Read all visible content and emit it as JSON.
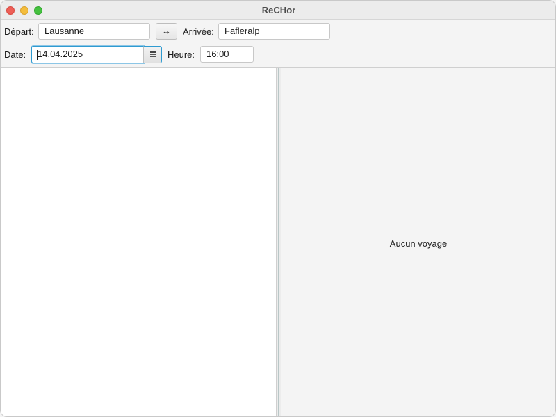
{
  "window": {
    "title": "ReCHor"
  },
  "form": {
    "depart_label": "Départ:",
    "depart_value": "Lausanne",
    "swap_label": "↔",
    "arrivee_label": "Arrivée:",
    "arrivee_value": "Fafleralp",
    "date_label": "Date:",
    "date_value": "14.04.2025",
    "calendar_icon": "calendar-icon",
    "heure_label": "Heure:",
    "heure_value": "16:00"
  },
  "results": {
    "empty_message": "Aucun voyage"
  },
  "colors": {
    "focus_accent": "#2f9bd1",
    "close": "#ee5f57",
    "minimize": "#f4bd3c",
    "maximize": "#45c13f"
  }
}
